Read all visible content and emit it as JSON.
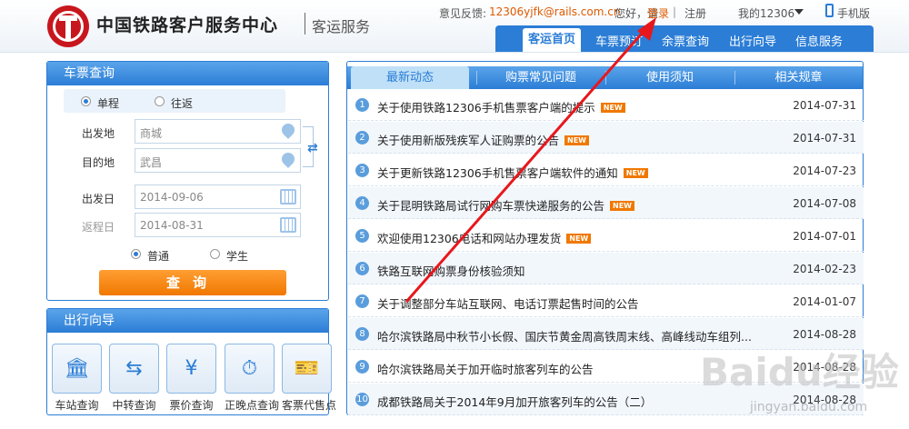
{
  "header": {
    "brand": "中国铁路客户服务中心",
    "subtitle": "客运服务",
    "feedback_label": "意见反馈:",
    "feedback_email": "12306yjfk@rails.com.cn",
    "greeting": "您好，请",
    "login": "登录",
    "separator": "|",
    "register": "注册",
    "my_account": "我的12306",
    "mobile": "手机版",
    "nav": [
      "客运首页",
      "车票预订",
      "余票查询",
      "出行向导",
      "信息服务"
    ]
  },
  "ticket_query": {
    "title": "车票查询",
    "trip_types": [
      "单程",
      "往返"
    ],
    "from_label": "出发地",
    "from_value": "商城",
    "to_label": "目的地",
    "to_value": "武昌",
    "depart_label": "出发日",
    "depart_value": "2014-09-06",
    "return_label": "返程日",
    "return_value": "2014-08-31",
    "passenger_types": [
      "普通",
      "学生"
    ],
    "search_button": "查询"
  },
  "travel_guide": {
    "title": "出行向导",
    "items": [
      {
        "label": "车站查询",
        "icon": "station-icon"
      },
      {
        "label": "中转查询",
        "icon": "transfer-icon"
      },
      {
        "label": "票价查询",
        "icon": "price-search-icon"
      },
      {
        "label": "正晚点查询",
        "icon": "clock-icon"
      },
      {
        "label": "客票代售点",
        "icon": "ticket-agency-icon"
      }
    ]
  },
  "news": {
    "tabs": [
      "最新动态",
      "购票常见问题",
      "使用须知",
      "相关规章"
    ],
    "new_badge": "NEW",
    "items": [
      {
        "num": "1",
        "title": "关于使用铁路12306手机售票客户端的提示",
        "date": "2014-07-31",
        "new": true
      },
      {
        "num": "2",
        "title": "关于使用新版残疾军人证购票的公告",
        "date": "2014-07-31",
        "new": true
      },
      {
        "num": "3",
        "title": "关于更新铁路12306手机售票客户端软件的通知",
        "date": "2014-07-23",
        "new": true
      },
      {
        "num": "4",
        "title": "关于昆明铁路局试行网购车票快递服务的公告",
        "date": "2014-07-08",
        "new": true
      },
      {
        "num": "5",
        "title": "欢迎使用12306电话和网站办理发货",
        "date": "2014-07-01",
        "new": true
      },
      {
        "num": "6",
        "title": "铁路互联网购票身份核验须知",
        "date": "2014-02-23",
        "new": false
      },
      {
        "num": "7",
        "title": "关于调整部分车站互联网、电话订票起售时间的公告",
        "date": "2014-01-07",
        "new": false
      },
      {
        "num": "8",
        "title": "哈尔滨铁路局中秋节小长假、国庆节黄金周高铁周末线、高峰线动车组列...",
        "date": "2014-08-28",
        "new": false
      },
      {
        "num": "9",
        "title": "哈尔滨铁路局关于加开临时旅客列车的公告",
        "date": "2014-08-28",
        "new": false
      },
      {
        "num": "10",
        "title": "成都铁路局关于2014年9月加开旅客列车的公告（二）",
        "date": "2014-08-28",
        "new": false
      }
    ]
  },
  "watermark": {
    "text": "Baidu经验",
    "sub": "jingyan.baidu.com"
  },
  "colors": {
    "brand_red": "#c8161d",
    "primary_blue": "#2b7dd6",
    "accent_orange": "#f07800",
    "annotation_red": "#e8171c"
  }
}
